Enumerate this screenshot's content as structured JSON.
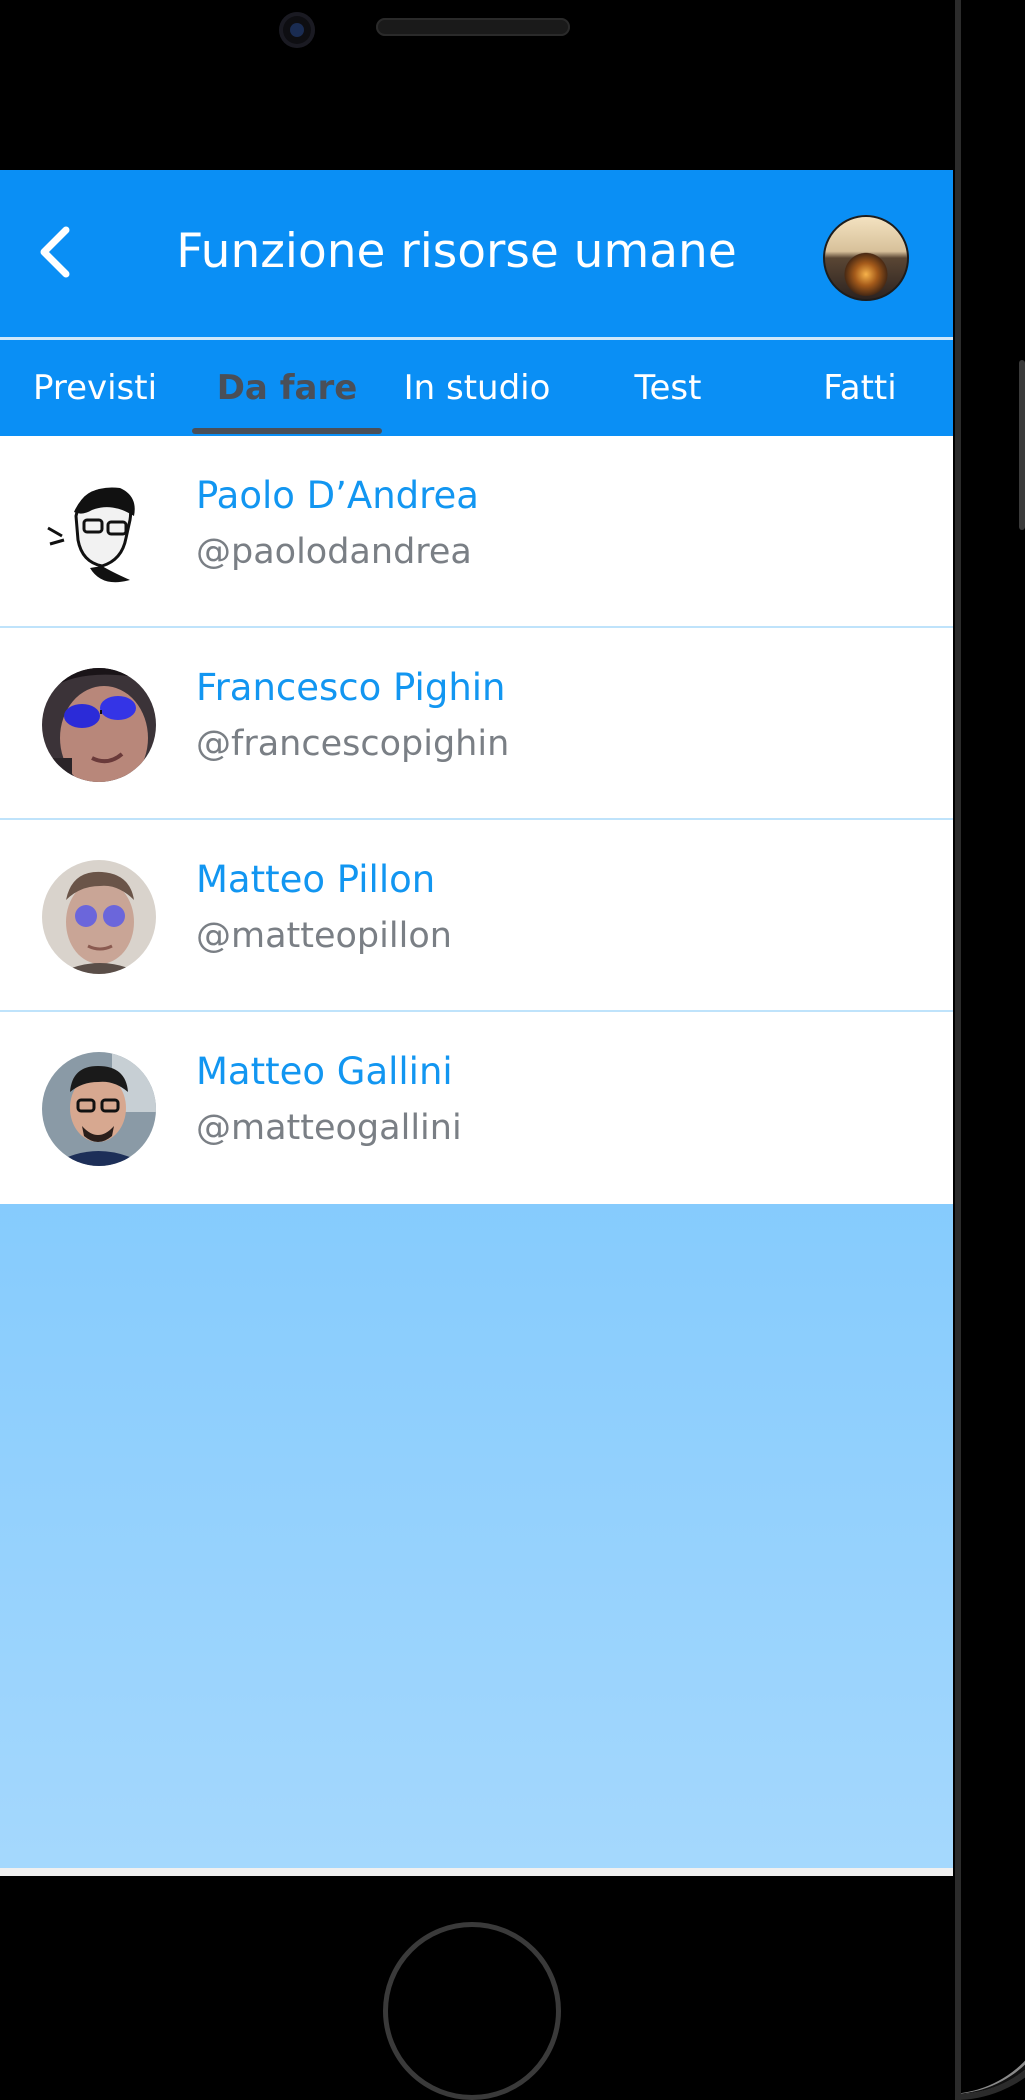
{
  "header": {
    "title": "Funzione risorse umane",
    "back_icon": "chevron-left-icon",
    "avatar_icon": "sunset-avatar"
  },
  "tabs": [
    {
      "label": "Previsti",
      "active": false
    },
    {
      "label": "Da fare",
      "active": true
    },
    {
      "label": "In studio",
      "active": false
    },
    {
      "label": "Test",
      "active": false
    },
    {
      "label": "Fatti",
      "active": false
    }
  ],
  "users": [
    {
      "name": "Paolo D’Andrea",
      "handle": "@paolodandrea"
    },
    {
      "name": "Francesco Pighin",
      "handle": "@francescopighin"
    },
    {
      "name": "Matteo Pillon",
      "handle": "@matteopillon"
    },
    {
      "name": "Matteo Gallini",
      "handle": "@matteogallini"
    }
  ],
  "colors": {
    "primary": "#0a8ff5",
    "name_text": "#1296f1",
    "handle_text": "#7a7f85",
    "active_tab": "#4a4f58"
  }
}
